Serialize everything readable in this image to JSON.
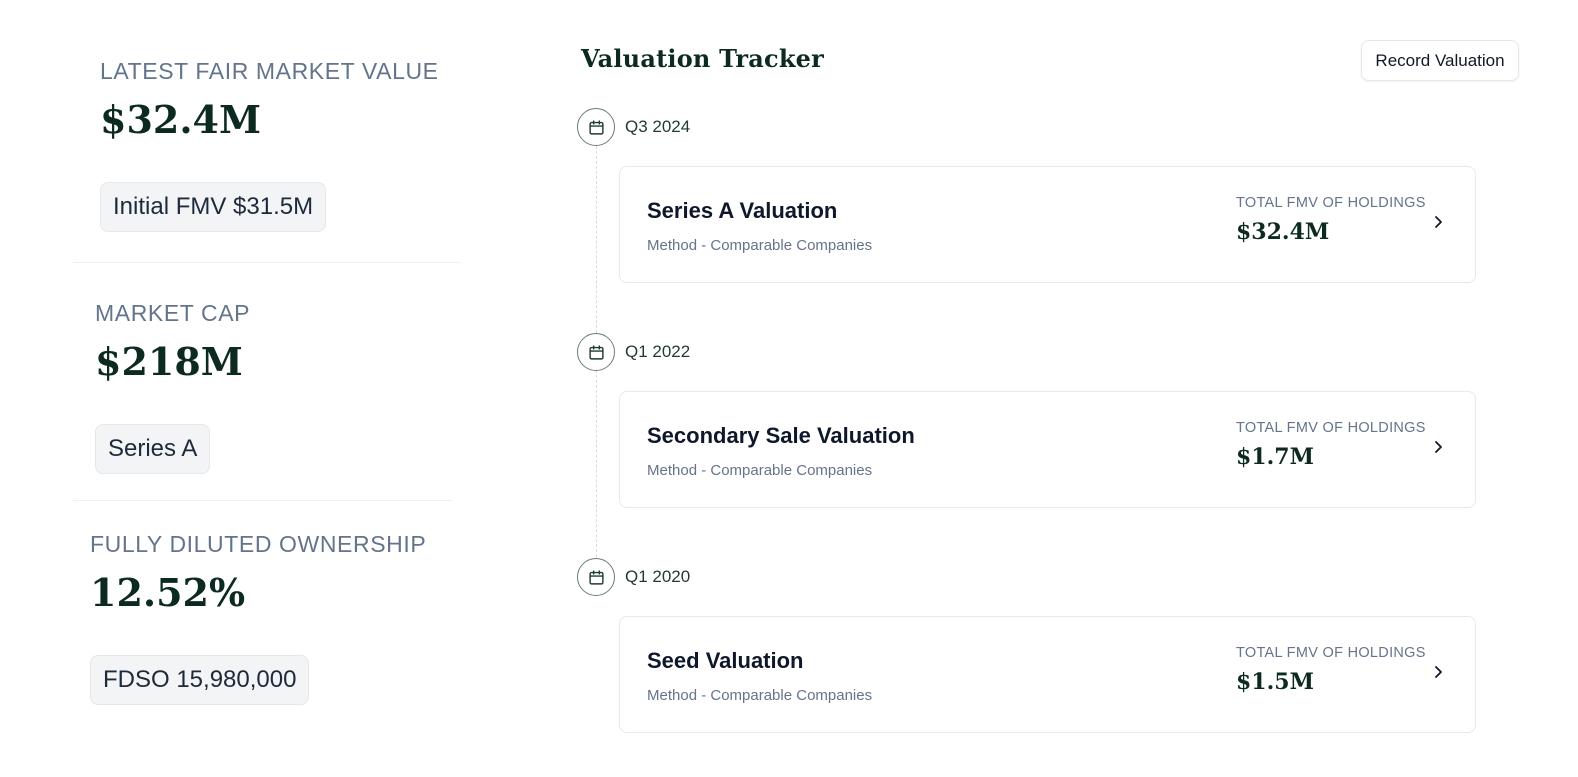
{
  "stats": [
    {
      "label": "LATEST FAIR MARKET VALUE",
      "value": "$32.4M",
      "chip": "Initial FMV $31.5M"
    },
    {
      "label": "MARKET CAP",
      "value": "$218M",
      "chip": "Series A"
    },
    {
      "label": "FULLY DILUTED OWNERSHIP",
      "value": "12.52%",
      "chip": "FDSO 15,980,000"
    }
  ],
  "tracker": {
    "title": "Valuation Tracker",
    "record_button": "Record Valuation",
    "entries": [
      {
        "date": "Q3 2024",
        "name": "Series A Valuation",
        "method": "Method - Comparable Companies",
        "fmv_label": "TOTAL FMV OF HOLDINGS",
        "fmv_value": "$32.4M"
      },
      {
        "date": "Q1 2022",
        "name": "Secondary Sale Valuation",
        "method": "Method - Comparable Companies",
        "fmv_label": "TOTAL FMV OF HOLDINGS",
        "fmv_value": "$1.7M"
      },
      {
        "date": "Q1 2020",
        "name": "Seed Valuation",
        "method": "Method - Comparable Companies",
        "fmv_label": "TOTAL FMV OF HOLDINGS",
        "fmv_value": "$1.5M"
      }
    ]
  },
  "icons": {
    "date_node": "calendar-icon",
    "card_action": "chevron-right-icon"
  },
  "colors": {
    "heading": "#0d2a22",
    "muted": "#64748b",
    "border": "#e6e9ed",
    "chip_bg": "#f3f4f6"
  }
}
